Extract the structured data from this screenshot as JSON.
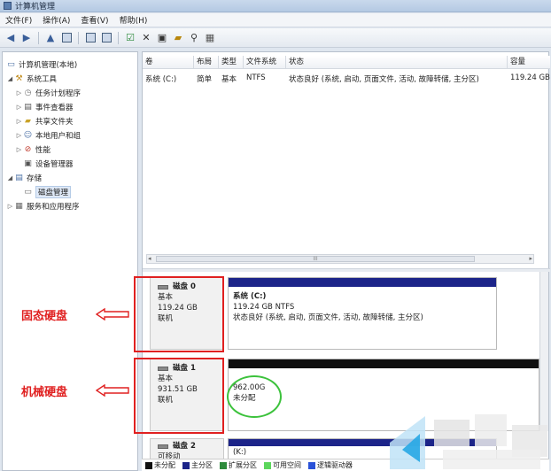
{
  "window": {
    "title": "计算机管理"
  },
  "menu": [
    {
      "label": "文件(F)"
    },
    {
      "label": "操作(A)"
    },
    {
      "label": "查看(V)"
    },
    {
      "label": "帮助(H)"
    }
  ],
  "tree": {
    "root": "计算机管理(本地)",
    "system_tools": "系统工具",
    "items": [
      "任务计划程序",
      "事件查看器",
      "共享文件夹",
      "本地用户和组",
      "性能",
      "设备管理器"
    ],
    "storage": "存储",
    "disk_mgmt": "磁盘管理",
    "services": "服务和应用程序"
  },
  "volume_table": {
    "headers": [
      "卷",
      "布局",
      "类型",
      "文件系统",
      "状态",
      "容量"
    ],
    "rows": [
      [
        "系统 (C:)",
        "简单",
        "基本",
        "NTFS",
        "状态良好 (系统, 启动, 页面文件, 活动, 故障转储, 主分区)",
        "119.24 GB"
      ]
    ],
    "scroll_marker": "III"
  },
  "disks": [
    {
      "name": "磁盘 0",
      "type": "基本",
      "size": "119.24 GB",
      "status": "联机",
      "partition": {
        "name": "系统 (C:)",
        "size": "119.24 GB NTFS",
        "status": "状态良好 (系统, 启动, 页面文件, 活动, 故障转储, 主分区)"
      }
    },
    {
      "name": "磁盘 1",
      "type": "基本",
      "size": "931.51 GB",
      "status": "联机",
      "partition": {
        "name": "962.00G",
        "status": "未分配"
      }
    },
    {
      "name": "磁盘 2",
      "type": "可移动",
      "partition_name": "(K:)"
    }
  ],
  "annotations": {
    "ssd": "固态硬盘",
    "hdd": "机械硬盘"
  },
  "legend": [
    {
      "label": "未分配",
      "color": "#101010"
    },
    {
      "label": "主分区",
      "color": "#1c2489"
    },
    {
      "label": "扩展分区",
      "color": "#2e8b3c"
    },
    {
      "label": "可用空间",
      "color": "#5cd65c"
    },
    {
      "label": "逻辑驱动器",
      "color": "#2a52d8"
    }
  ],
  "colors": {
    "annotation_red": "#e02020",
    "highlight_green": "#3cc23c"
  }
}
